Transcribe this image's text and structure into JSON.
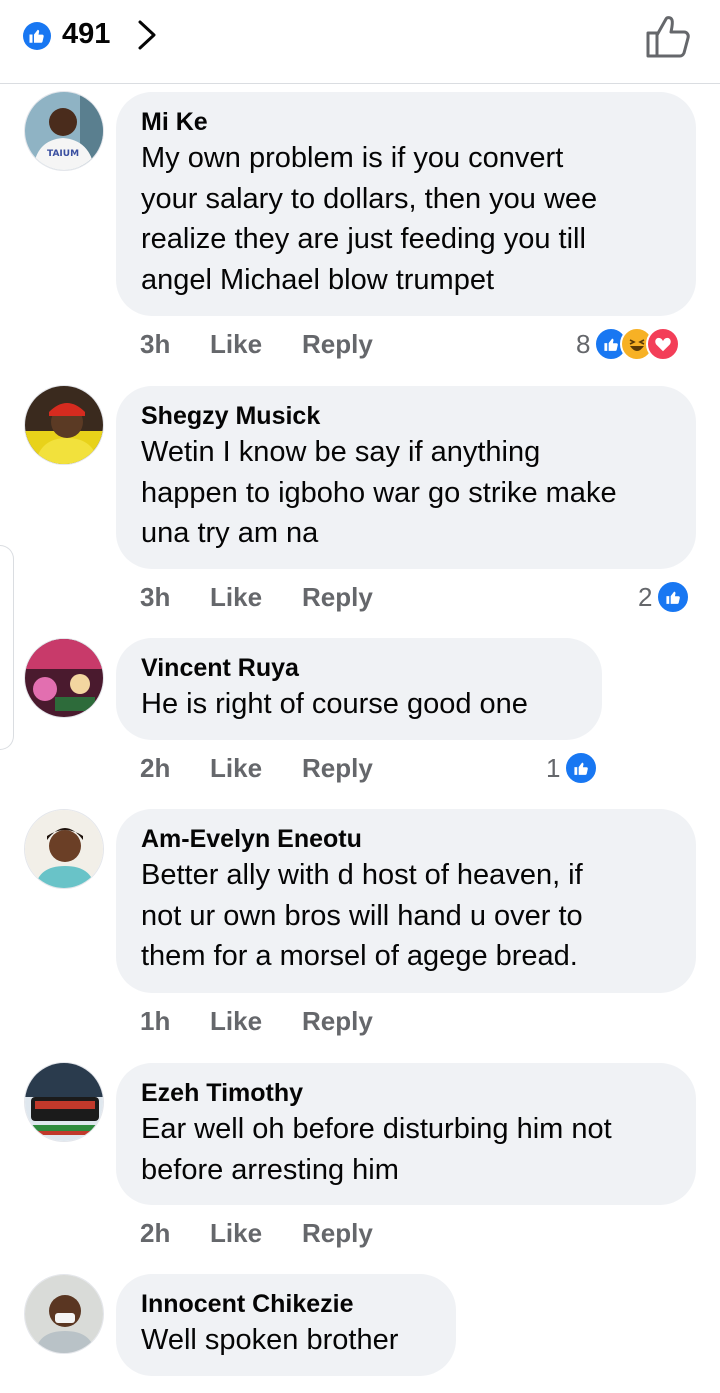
{
  "header": {
    "like_count": "491",
    "icons": {
      "like_badge": "like-icon",
      "chevron": "chevron-right-icon",
      "thumb": "thumbs-up-outline-icon"
    }
  },
  "comments": [
    {
      "author": "Mi Ke",
      "lines": [
        "My own problem  is if you convert",
        "your salary to dollars, then you wee",
        "realize they are just feeding you till",
        "angel Michael blow trumpet"
      ],
      "time": "3h",
      "like_label": "Like",
      "reply_label": "Reply",
      "reaction_count": "8",
      "reactions": [
        "like",
        "haha",
        "love"
      ]
    },
    {
      "author": "Shegzy Musick",
      "lines": [
        "Wetin I know be say if anything",
        "happen to igboho war go strike make",
        "una try am na"
      ],
      "time": "3h",
      "like_label": "Like",
      "reply_label": "Reply",
      "reaction_count": "2",
      "reactions": [
        "like"
      ]
    },
    {
      "author": "Vincent Ruya",
      "lines": [
        "He is right of course good one"
      ],
      "time": "2h",
      "like_label": "Like",
      "reply_label": "Reply",
      "reaction_count": "1",
      "reactions": [
        "like"
      ]
    },
    {
      "author": "Am-Evelyn Eneotu",
      "lines": [
        "Better ally with d host of heaven, if",
        "not ur own bros will hand u over to",
        "them for a morsel of agege bread."
      ],
      "time": "1h",
      "like_label": "Like",
      "reply_label": "Reply",
      "reaction_count": "",
      "reactions": []
    },
    {
      "author": "Ezeh Timothy",
      "lines": [
        "Ear well oh before disturbing him not",
        "before arresting him"
      ],
      "time": "2h",
      "like_label": "Like",
      "reply_label": "Reply",
      "reaction_count": "",
      "reactions": []
    },
    {
      "author": "Innocent Chikezie",
      "lines": [
        "Well spoken brother"
      ],
      "time": "",
      "like_label": "",
      "reply_label": "",
      "reaction_count": "",
      "reactions": []
    }
  ],
  "colors": {
    "accent": "#1877f2",
    "bubble": "#f0f2f5",
    "meta_text": "#65676b",
    "haha": "#f7b125",
    "love": "#f33e58"
  }
}
